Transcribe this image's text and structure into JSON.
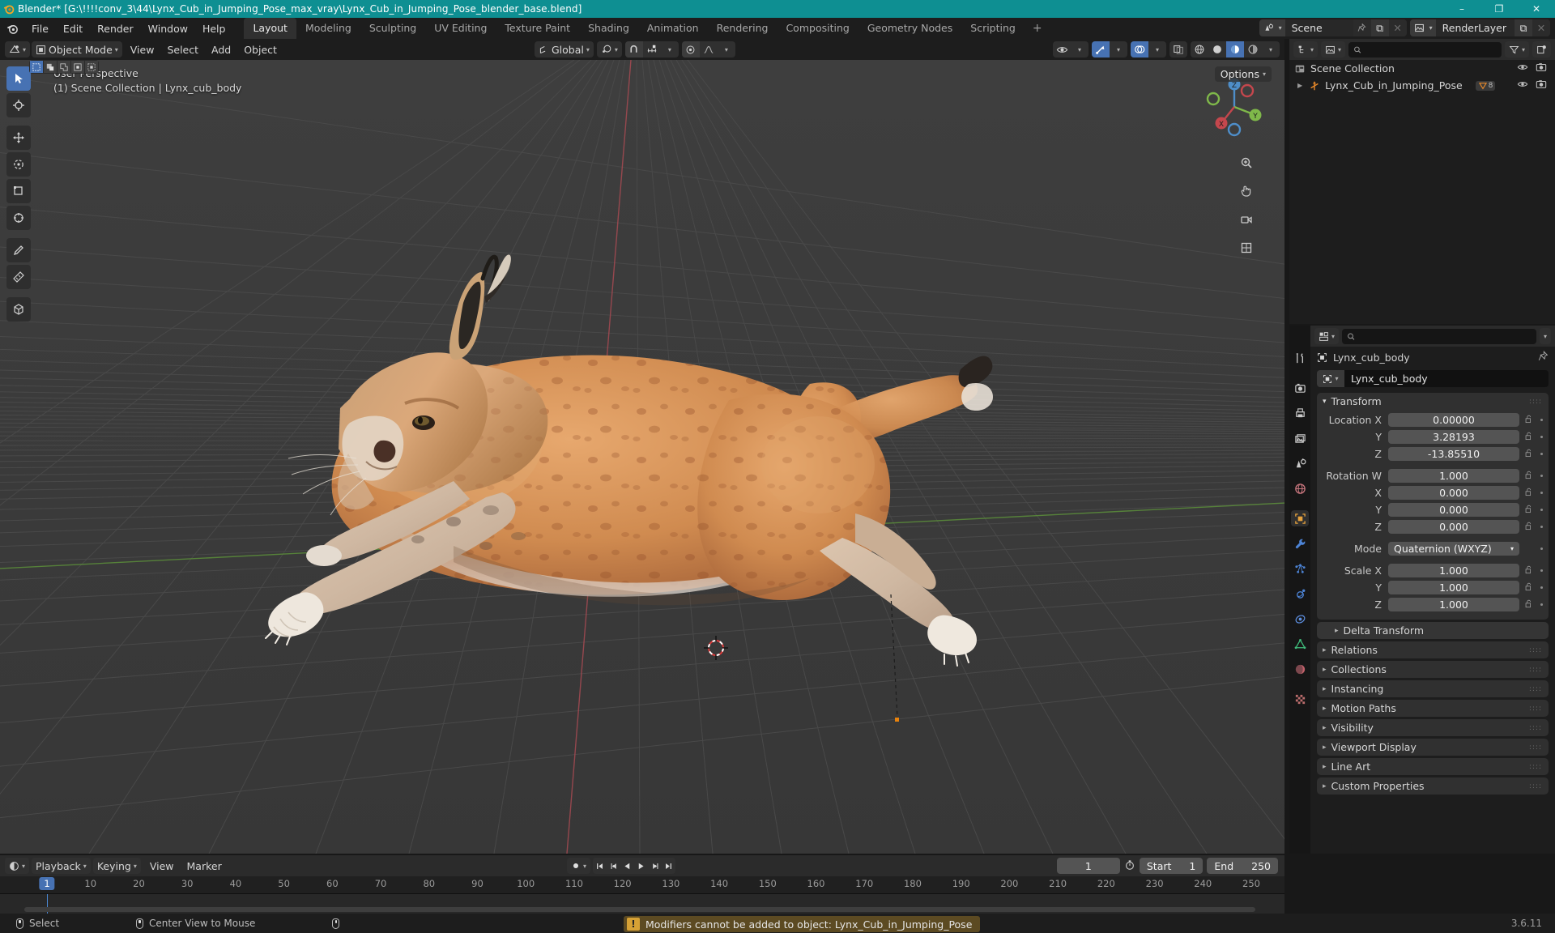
{
  "window": {
    "title": "Blender* [G:\\!!!!conv_3\\44\\Lynx_Cub_in_Jumping_Pose_max_vray\\Lynx_Cub_in_Jumping_Pose_blender_base.blend]",
    "minimize": "–",
    "maximize": "❐",
    "close": "✕",
    "titlebar_color": "#0e8f92"
  },
  "topbar": {
    "menus": [
      "File",
      "Edit",
      "Render",
      "Window",
      "Help"
    ],
    "workspaces": [
      {
        "label": "Layout",
        "active": true
      },
      {
        "label": "Modeling",
        "active": false
      },
      {
        "label": "Sculpting",
        "active": false
      },
      {
        "label": "UV Editing",
        "active": false
      },
      {
        "label": "Texture Paint",
        "active": false
      },
      {
        "label": "Shading",
        "active": false
      },
      {
        "label": "Animation",
        "active": false
      },
      {
        "label": "Rendering",
        "active": false
      },
      {
        "label": "Compositing",
        "active": false
      },
      {
        "label": "Geometry Nodes",
        "active": false
      },
      {
        "label": "Scripting",
        "active": false
      }
    ],
    "add_workspace": "+",
    "scene": {
      "name": "Scene",
      "new_label": "⧉",
      "remove_label": "✕"
    },
    "view_layer": {
      "name": "RenderLayer",
      "new_label": "⧉",
      "remove_label": "✕"
    }
  },
  "viewport": {
    "mode": "Object Mode",
    "menus": [
      "View",
      "Select",
      "Add",
      "Object"
    ],
    "transform_orientation": "Global",
    "options_label": "Options",
    "info_line1": "User Perspective",
    "info_line2": "(1) Scene Collection | Lynx_cub_body",
    "select_modes": [
      "tweak",
      "box-select",
      "circle-select",
      "lasso-select",
      "select-box-extend"
    ],
    "gizmo_axes": {
      "x": "X",
      "y": "Y",
      "z": "Z"
    },
    "accent_blue": "#4772b3",
    "background": "#3b3b3b"
  },
  "outliner": {
    "search_placeholder": "",
    "display_mode": "View Layer",
    "rows": [
      {
        "label": "Scene Collection",
        "icon": "collection-icon",
        "indent": 0,
        "expandable": false
      },
      {
        "label": "Lynx_Cub_in_Jumping_Pose",
        "icon": "empty-axes-icon",
        "indent": 1,
        "expandable": true,
        "badge": "8"
      }
    ]
  },
  "properties": {
    "tabs": [
      {
        "name": "tool",
        "icon": "wrench-screwdriver-icon",
        "active": false,
        "color": "#c9c9c9"
      },
      {
        "name": "render",
        "icon": "camera-back-icon",
        "active": false,
        "color": "#c9c9c9"
      },
      {
        "name": "output",
        "icon": "printer-icon",
        "active": false,
        "color": "#c9c9c9"
      },
      {
        "name": "view-layer",
        "icon": "images-icon",
        "active": false,
        "color": "#c9c9c9"
      },
      {
        "name": "scene",
        "icon": "cone-sphere-icon",
        "active": false,
        "color": "#c9c9c9"
      },
      {
        "name": "world",
        "icon": "world-icon",
        "active": false,
        "color": "#c9767e"
      },
      {
        "name": "object",
        "icon": "object-square-icon",
        "active": true,
        "color": "#e8a33d"
      },
      {
        "name": "modifiers",
        "icon": "wrench-icon",
        "active": false,
        "color": "#4d84d6"
      },
      {
        "name": "particles",
        "icon": "particles-icon",
        "active": false,
        "color": "#4d84d6"
      },
      {
        "name": "physics",
        "icon": "physics-orbit-icon",
        "active": false,
        "color": "#4d84d6"
      },
      {
        "name": "constraints",
        "icon": "constraint-icon",
        "active": false,
        "color": "#5d8fe0"
      },
      {
        "name": "data",
        "icon": "mesh-data-icon",
        "active": false,
        "color": "#3fba7a"
      },
      {
        "name": "material",
        "icon": "material-sphere-icon",
        "active": false,
        "color": "#c0606a"
      },
      {
        "name": "texture",
        "icon": "checker-texture-icon",
        "active": false,
        "color": "#bc6d6d"
      }
    ],
    "search_placeholder": "",
    "breadcrumb": "Lynx_cub_body",
    "object_name": "Lynx_cub_body",
    "transform": {
      "title": "Transform",
      "location": {
        "label": "Location X",
        "x": "0.00000",
        "y": "3.28193",
        "z": "-13.85510",
        "y_label": "Y",
        "z_label": "Z"
      },
      "rotation": {
        "label": "Rotation W",
        "w": "1.000",
        "x": "0.000",
        "y": "0.000",
        "z": "0.000",
        "x_label": "X",
        "y_label": "Y",
        "z_label": "Z"
      },
      "mode": {
        "label": "Mode",
        "value": "Quaternion (WXYZ)"
      },
      "scale": {
        "label": "Scale X",
        "x": "1.000",
        "y": "1.000",
        "z": "1.000",
        "y_label": "Y",
        "z_label": "Z"
      }
    },
    "panels": [
      {
        "label": "Delta Transform",
        "sub": true
      },
      {
        "label": "Relations",
        "sub": false
      },
      {
        "label": "Collections",
        "sub": false
      },
      {
        "label": "Instancing",
        "sub": false
      },
      {
        "label": "Motion Paths",
        "sub": false
      },
      {
        "label": "Visibility",
        "sub": false
      },
      {
        "label": "Viewport Display",
        "sub": false
      },
      {
        "label": "Line Art",
        "sub": false
      },
      {
        "label": "Custom Properties",
        "sub": false
      }
    ]
  },
  "timeline": {
    "menus": [
      "Playback",
      "Keying",
      "View",
      "Marker"
    ],
    "current_frame": "1",
    "start_label": "Start",
    "start_value": "1",
    "end_label": "End",
    "end_value": "250",
    "ticks": [
      "1",
      "10",
      "20",
      "30",
      "40",
      "50",
      "60",
      "70",
      "80",
      "90",
      "100",
      "110",
      "120",
      "130",
      "140",
      "150",
      "160",
      "170",
      "180",
      "190",
      "200",
      "210",
      "220",
      "230",
      "240",
      "250"
    ],
    "playhead_frame": "1"
  },
  "statusbar": {
    "left_items": [
      {
        "label": "Select",
        "icon": "mouse-left-icon"
      },
      {
        "label": "Center View to Mouse",
        "icon": "mouse-middle-icon"
      },
      {
        "label": "",
        "icon": "mouse-right-icon"
      }
    ],
    "report": {
      "text": "Modifiers cannot be added to object: Lynx_Cub_in_Jumping_Pose",
      "icon": "warning-icon",
      "color": "#5c4a22"
    },
    "version": "3.6.11"
  }
}
